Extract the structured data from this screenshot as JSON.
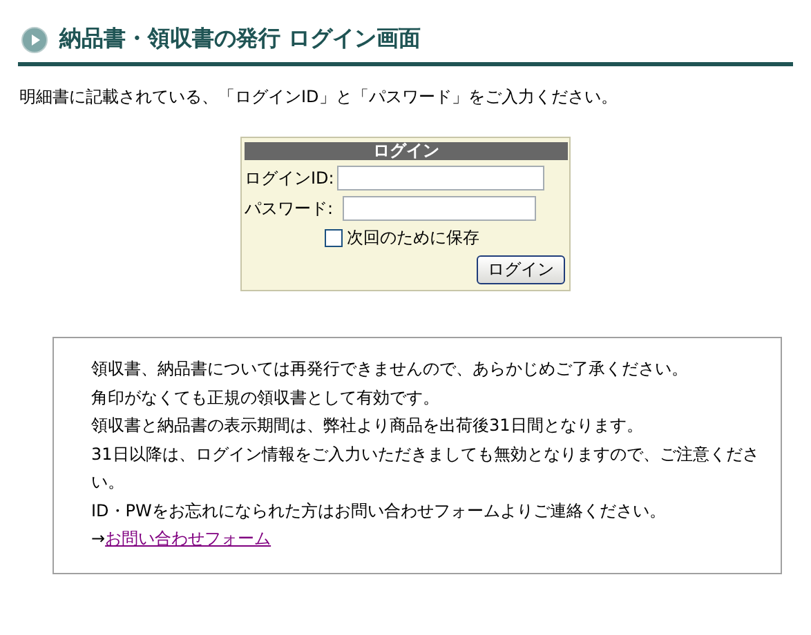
{
  "title": "納品書・領収書の発行 ログイン画面",
  "intro": "明細書に記載されている、「ログインID」と「パスワード」をご入力ください。",
  "login": {
    "heading": "ログイン",
    "fields": [
      {
        "label": "ログインID:",
        "kind": "text"
      },
      {
        "label": "パスワード:",
        "kind": "password"
      }
    ],
    "remember": {
      "label": "次回のために保存",
      "checked": false
    },
    "submit": "ログイン"
  },
  "notice": {
    "lines": [
      "領収書、納品書については再発行できませんので、あらかじめご了承ください。",
      "角印がなくても正規の領収書として有効です。",
      "領収書と納品書の表示期間は、弊社より商品を出荷後31日間となります。",
      "31日以降は、ログイン情報をご入力いただきましても無効となりますので、ご注意ください。",
      "ID・PWをお忘れになられた方はお問い合わせフォームよりご連絡ください。"
    ],
    "link_prefix": "→",
    "link": "お問い合わせフォーム"
  }
}
